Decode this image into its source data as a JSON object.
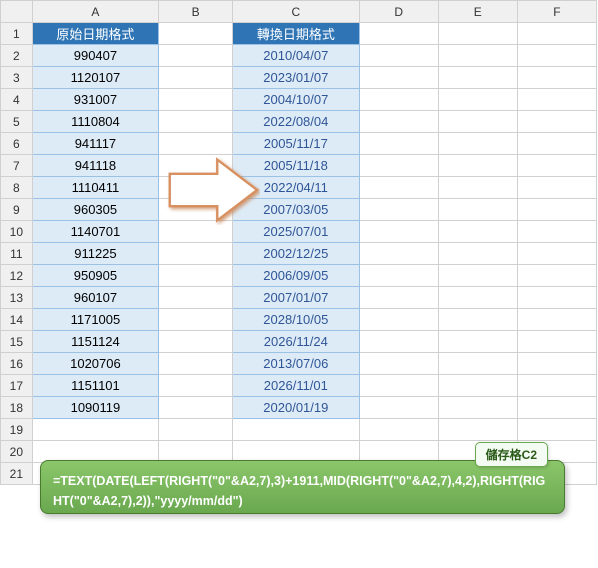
{
  "columns": [
    "A",
    "B",
    "C",
    "D",
    "E",
    "F"
  ],
  "rows": [
    1,
    2,
    3,
    4,
    5,
    6,
    7,
    8,
    9,
    10,
    11,
    12,
    13,
    14,
    15,
    16,
    17,
    18,
    19,
    20,
    21
  ],
  "headers": {
    "a": "原始日期格式",
    "c": "轉換日期格式"
  },
  "data": [
    {
      "a": "990407",
      "c": "2010/04/07"
    },
    {
      "a": "1120107",
      "c": "2023/01/07"
    },
    {
      "a": "931007",
      "c": "2004/10/07"
    },
    {
      "a": "1110804",
      "c": "2022/08/04"
    },
    {
      "a": "941117",
      "c": "2005/11/17"
    },
    {
      "a": "941118",
      "c": "2005/11/18"
    },
    {
      "a": "1110411",
      "c": "2022/04/11"
    },
    {
      "a": "960305",
      "c": "2007/03/05"
    },
    {
      "a": "1140701",
      "c": "2025/07/01"
    },
    {
      "a": "911225",
      "c": "2002/12/25"
    },
    {
      "a": "950905",
      "c": "2006/09/05"
    },
    {
      "a": "960107",
      "c": "2007/01/07"
    },
    {
      "a": "1171005",
      "c": "2028/10/05"
    },
    {
      "a": "1151124",
      "c": "2026/11/24"
    },
    {
      "a": "1020706",
      "c": "2013/07/06"
    },
    {
      "a": "1151101",
      "c": "2026/11/01"
    },
    {
      "a": "1090119",
      "c": "2020/01/19"
    }
  ],
  "badge": "儲存格C2",
  "formula": "=TEXT(DATE(LEFT(RIGHT(\"0\"&A2,7),3)+1911,MID(RIGHT(\"0\"&A2,7),4,2),RIGHT(RIGHT(\"0\"&A2,7),2)),\"yyyy/mm/dd\")"
}
